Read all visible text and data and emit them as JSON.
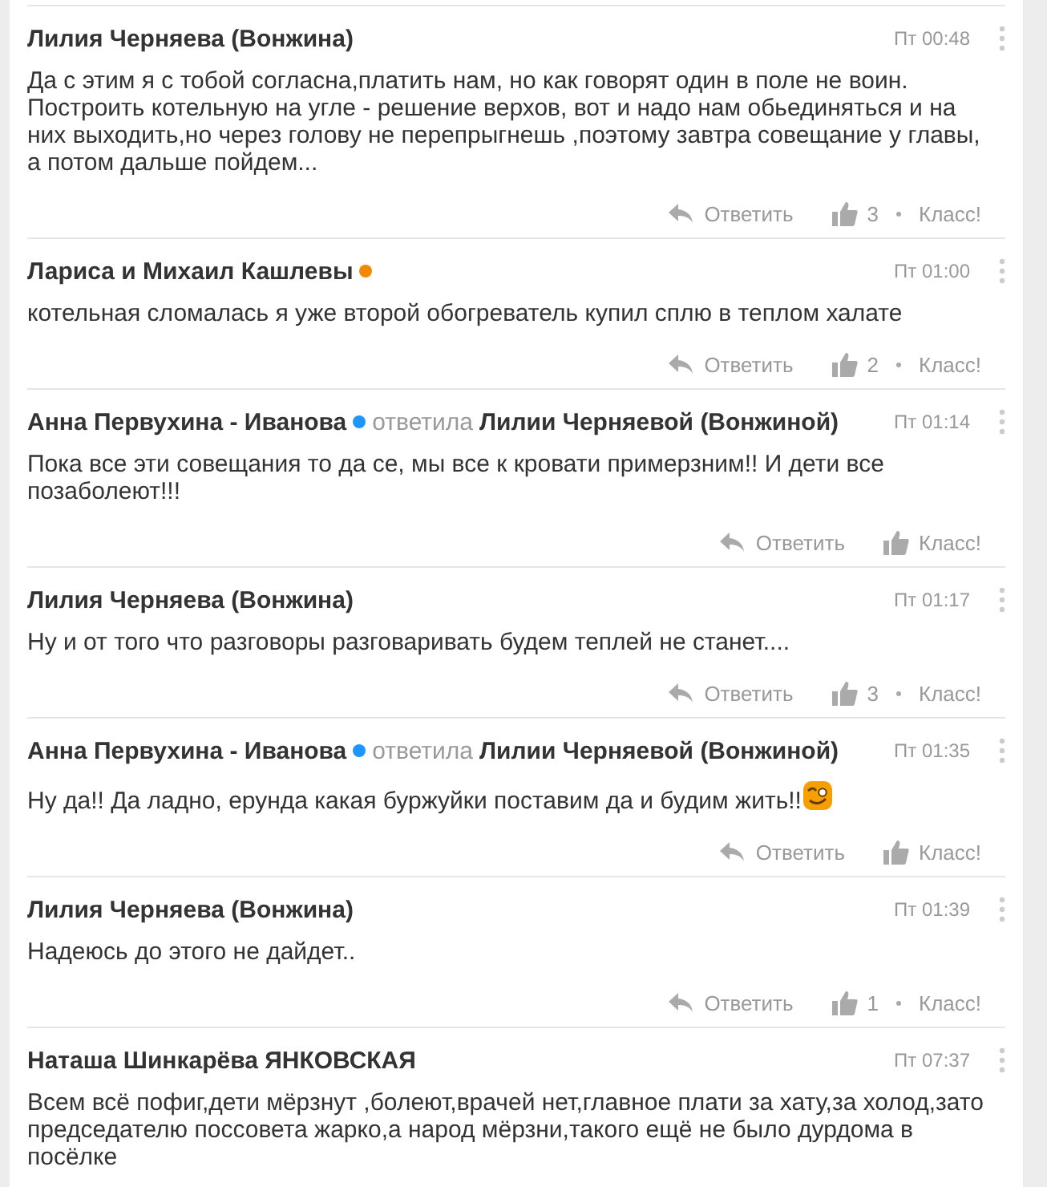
{
  "comments": [
    {
      "author": "Лилия Черняева (Вонжина)",
      "time": "Пт 00:48",
      "text": "Да с этим я с тобой согласна,платить нам, но как говорят один в поле не воин. Построить котельную на угле - решение верхов, вот и надо нам обьединяться  и на них выходить,но через голову не перепрыгнешь ,поэтому завтра совещание у главы, а потом дальше пойдем...",
      "reply_label": "Ответить",
      "likes": "3",
      "like_label": "Класс!"
    },
    {
      "author": "Лариса и Михаил Кашлевы",
      "color": "#f08a00",
      "time": "Пт 01:00",
      "text": "котельная сломалась я уже второй обогреватель купил  сплю в теплом халате",
      "reply_label": "Ответить",
      "likes": "2",
      "like_label": "Класс!"
    },
    {
      "author": "Анна Первухина - Иванова",
      "color": "#1e96ff",
      "replied_word": "ответила",
      "replied_to": "Лилии Черняевой (Вонжиной)",
      "time": "Пт 01:14",
      "text": "Пока все эти совещания то да се, мы все к кровати примерзним!! И дети все позаболеют!!!",
      "reply_label": "Ответить",
      "like_label": "Класс!"
    },
    {
      "author": "Лилия Черняева (Вонжина)",
      "time": "Пт 01:17",
      "text": "Ну и от того что разговоры разговаривать будем теплей не станет....",
      "reply_label": "Ответить",
      "likes": "3",
      "like_label": "Класс!"
    },
    {
      "author": "Анна Первухина - Иванова",
      "color": "#1e96ff",
      "replied_word": "ответила",
      "replied_to": "Лилии Черняевой (Вонжиной)",
      "time": "Пт 01:35",
      "text": "Ну да!! Да ладно, ерунда какая буржуйки поставим да и будим жить!!",
      "emoji": true,
      "reply_label": "Ответить",
      "like_label": "Класс!"
    },
    {
      "author": "Лилия Черняева (Вонжина)",
      "time": "Пт 01:39",
      "text": "Надеюсь до этого не дайдет..",
      "reply_label": "Ответить",
      "likes": "1",
      "like_label": "Класс!"
    },
    {
      "author": "Наташа Шинкарёва ЯНКОВСКАЯ",
      "time": "Пт 07:37",
      "text": "Всем всё пофиг,дети мёрзнут ,болеют,врачей нет,главное плати за хату,за холод,зато председателю поссовета жарко,а народ мёрзни,такого ещё не было дурдома в посёлке"
    }
  ]
}
